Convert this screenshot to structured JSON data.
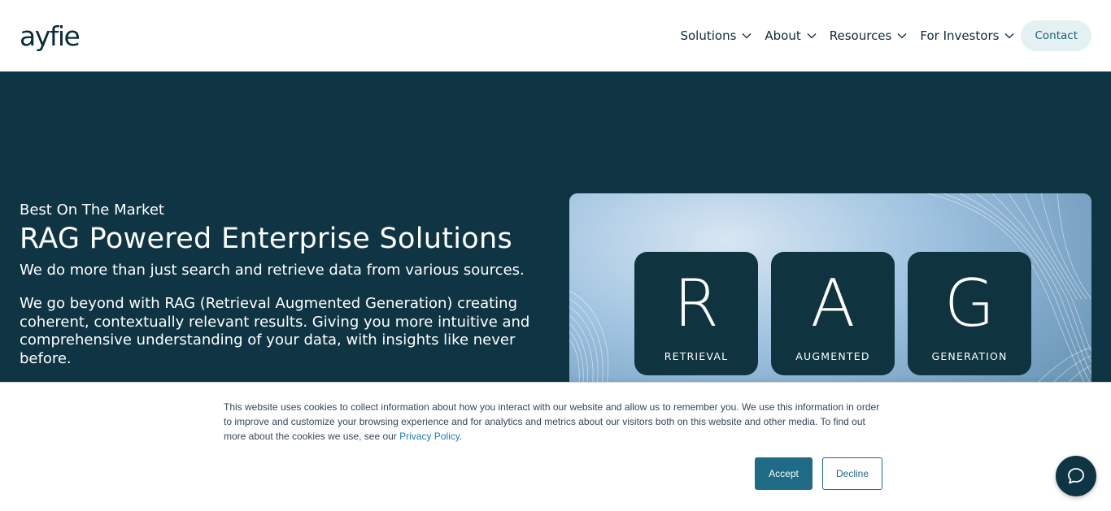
{
  "header": {
    "logo_text": "ayfie",
    "nav": [
      {
        "label": "Solutions",
        "icon": "chevron-down-icon"
      },
      {
        "label": "About",
        "icon": "chevron-down-icon"
      },
      {
        "label": "Resources",
        "icon": "chevron-down-icon"
      },
      {
        "label": "For Investors",
        "icon": "chevron-down-icon"
      }
    ],
    "contact_label": "Contact"
  },
  "hero": {
    "eyebrow": "Best On The Market",
    "title": "RAG Powered Enterprise Solutions",
    "paragraph1": "We do more than just search and retrieve data from various sources.",
    "paragraph2": "We go beyond with RAG (Retrieval Augmented Generation) creating coherent, contextually relevant results. Giving you more intuitive and comprehensive understanding of your data, with insights like never before.",
    "rag_tiles": [
      {
        "letter": "R",
        "word": "RETRIEVAL"
      },
      {
        "letter": "A",
        "word": "AUGMENTED"
      },
      {
        "letter": "G",
        "word": "GENERATION"
      }
    ]
  },
  "cookie_banner": {
    "text": "This website uses cookies to collect information about how you interact with our website and allow us to remember you. We use this information in order to improve and customize your browsing experience and for analytics and metrics about our visitors both on this website and other media. To find out more about the cookies we use, see our ",
    "link_text": "Privacy Policy",
    "text_end": ".",
    "accept_label": "Accept",
    "decline_label": "Decline"
  },
  "chat": {
    "icon": "chat-bubble-icon"
  },
  "colors": {
    "brand_dark": "#0f3544",
    "accent": "#1f6a84",
    "contact_bg": "#e4f1f3",
    "link": "#1e7fb0"
  }
}
